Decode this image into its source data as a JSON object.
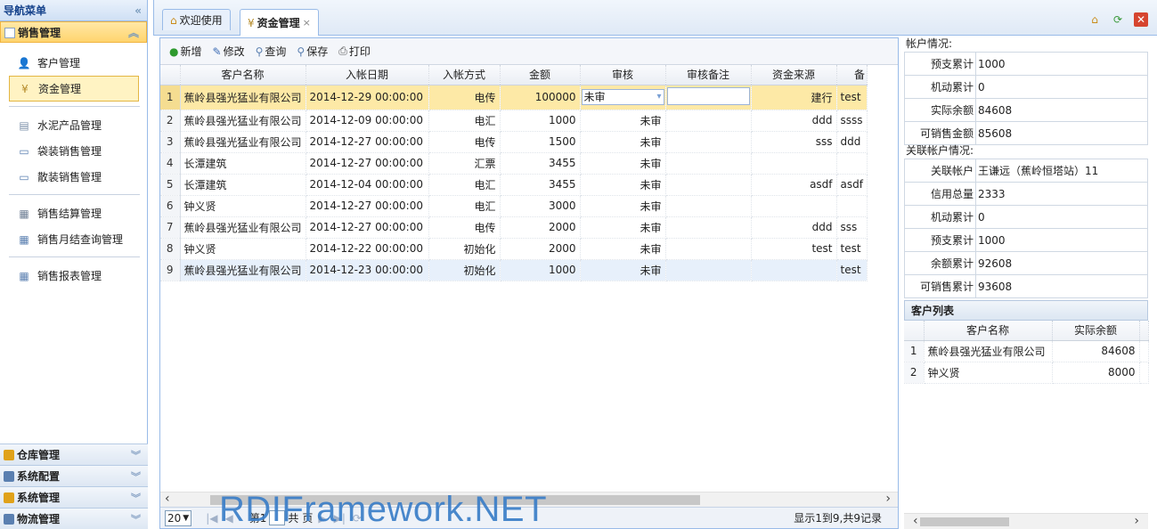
{
  "nav": {
    "title": "导航菜单",
    "collapse_icon": "double-chevron-left",
    "active_section": "销售管理",
    "items": [
      {
        "label": "客户管理",
        "icon": "person-icon"
      },
      {
        "label": "资金管理",
        "icon": "yen-icon"
      },
      {
        "label": "水泥产品管理",
        "icon": "box-icon"
      },
      {
        "label": "袋装销售管理",
        "icon": "window-icon"
      },
      {
        "label": "散装销售管理",
        "icon": "window-icon"
      },
      {
        "label": "销售结算管理",
        "icon": "doc-icon"
      },
      {
        "label": "销售月结查询管理",
        "icon": "grid-icon"
      },
      {
        "label": "销售报表管理",
        "icon": "grid-icon"
      }
    ],
    "bottom_sections": [
      "仓库管理",
      "系统配置",
      "系统管理",
      "物流管理"
    ]
  },
  "tabs": [
    {
      "label": "欢迎使用",
      "icon": "home-icon"
    },
    {
      "label": "资金管理",
      "icon": "yen-icon",
      "close": "×"
    }
  ],
  "toolbar": {
    "add": "新增",
    "edit": "修改",
    "query": "查询",
    "save": "保存",
    "print": "打印"
  },
  "grid": {
    "columns": [
      "客户名称",
      "入帐日期",
      "入帐方式",
      "金额",
      "审核",
      "审核备注",
      "资金来源",
      "备"
    ],
    "rows": [
      {
        "n": "1",
        "name": "蕉岭县强光猛业有限公司",
        "date": "2014-12-29 00:00:00",
        "method": "电传",
        "amount": "100000",
        "audit": "未审",
        "note": "",
        "source": "建行",
        "remark": "test"
      },
      {
        "n": "2",
        "name": "蕉岭县强光猛业有限公司",
        "date": "2014-12-09 00:00:00",
        "method": "电汇",
        "amount": "1000",
        "audit": "未审",
        "note": "",
        "source": "ddd",
        "remark": "ssss"
      },
      {
        "n": "3",
        "name": "蕉岭县强光猛业有限公司",
        "date": "2014-12-27 00:00:00",
        "method": "电传",
        "amount": "1500",
        "audit": "未审",
        "note": "",
        "source": "sss",
        "remark": "ddd"
      },
      {
        "n": "4",
        "name": "长潭建筑",
        "date": "2014-12-27 00:00:00",
        "method": "汇票",
        "amount": "3455",
        "audit": "未审",
        "note": "",
        "source": "",
        "remark": ""
      },
      {
        "n": "5",
        "name": "长潭建筑",
        "date": "2014-12-04 00:00:00",
        "method": "电汇",
        "amount": "3455",
        "audit": "未审",
        "note": "",
        "source": "asdf",
        "remark": "asdf"
      },
      {
        "n": "6",
        "name": "钟义贤",
        "date": "2014-12-27 00:00:00",
        "method": "电汇",
        "amount": "3000",
        "audit": "未审",
        "note": "",
        "source": "",
        "remark": ""
      },
      {
        "n": "7",
        "name": "蕉岭县强光猛业有限公司",
        "date": "2014-12-27 00:00:00",
        "method": "电传",
        "amount": "2000",
        "audit": "未审",
        "note": "",
        "source": "ddd",
        "remark": "sss"
      },
      {
        "n": "8",
        "name": "钟义贤",
        "date": "2014-12-22 00:00:00",
        "method": "初始化",
        "amount": "2000",
        "audit": "未审",
        "note": "",
        "source": "test",
        "remark": "test"
      },
      {
        "n": "9",
        "name": "蕉岭县强光猛业有限公司",
        "date": "2014-12-23 00:00:00",
        "method": "初始化",
        "amount": "1000",
        "audit": "未审",
        "note": "",
        "source": "",
        "remark": "test"
      }
    ],
    "editing_audit_value": "未审"
  },
  "pager": {
    "page_size": "20",
    "page_label": "第1",
    "total_label": "共",
    "page_word": "页",
    "summary": "显示1到9,共9记录"
  },
  "watermark": "RDIFramework.NET",
  "account": {
    "title": "帐户情况:",
    "rows": [
      {
        "k": "预支累计",
        "v": "1000"
      },
      {
        "k": "机动累计",
        "v": "0"
      },
      {
        "k": "实际余额",
        "v": "84608"
      },
      {
        "k": "可销售金额",
        "v": "85608"
      }
    ]
  },
  "linked": {
    "title": "关联帐户情况:",
    "rows": [
      {
        "k": "关联帐户",
        "v": "王谦远（蕉岭恒塔站）11"
      },
      {
        "k": "信用总量",
        "v": "2333"
      },
      {
        "k": "机动累计",
        "v": "0"
      },
      {
        "k": "预支累计",
        "v": "1000"
      },
      {
        "k": "余额累计",
        "v": "92608"
      },
      {
        "k": "可销售累计",
        "v": "93608"
      }
    ]
  },
  "customers": {
    "title": "客户列表",
    "columns": [
      "客户名称",
      "实际余额"
    ],
    "rows": [
      {
        "n": "1",
        "name": "蕉岭县强光猛业有限公司",
        "balance": "84608"
      },
      {
        "n": "2",
        "name": "钟义贤",
        "balance": "8000"
      }
    ]
  }
}
